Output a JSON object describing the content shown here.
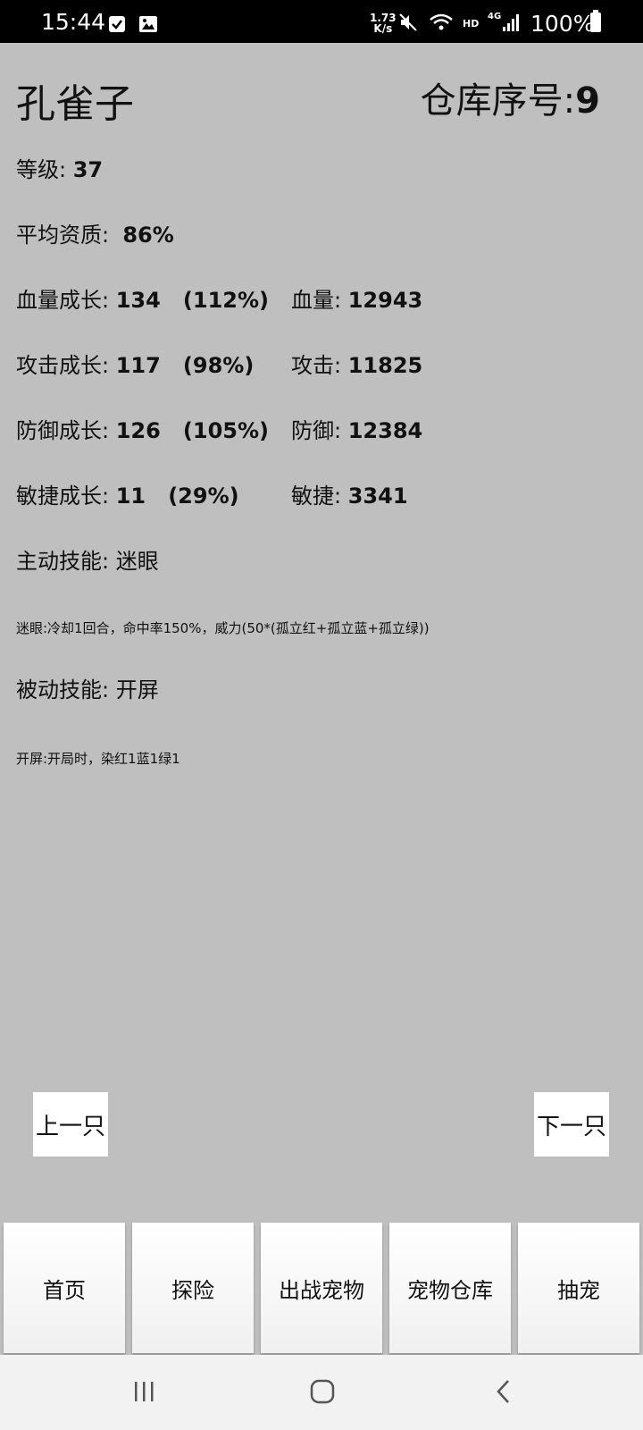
{
  "status_bar": {
    "time": "15:44",
    "net_speed_value": "1.73",
    "net_speed_unit": "K/s",
    "hd_label": "HD",
    "network_type": "4G",
    "battery_percent": "100%"
  },
  "header": {
    "pet_name": "孔雀子",
    "warehouse_label": "仓库序号:",
    "warehouse_number": "9"
  },
  "stats": {
    "level_label": "等级:",
    "level_value": "37",
    "avg_quality_label": "平均资质:",
    "avg_quality_value": "86%",
    "hp_growth_label": "血量成长:",
    "hp_growth_value": "134   (112%)",
    "hp_label": "血量:",
    "hp_value": "12943",
    "atk_growth_label": "攻击成长:",
    "atk_growth_value": "117   (98%)",
    "atk_label": "攻击:",
    "atk_value": "11825",
    "def_growth_label": "防御成长:",
    "def_growth_value": "126   (105%)",
    "def_label": "防御:",
    "def_value": "12384",
    "agi_growth_label": "敏捷成长:",
    "agi_growth_value": "11   (29%)",
    "agi_label": "敏捷:",
    "agi_value": "3341"
  },
  "skills": {
    "active_label": "主动技能:",
    "active_name": "迷眼",
    "active_desc": "迷眼:冷却1回合，命中率150%，威力(50*(孤立红+孤立蓝+孤立绿))",
    "passive_label": "被动技能:",
    "passive_name": "开屏",
    "passive_desc": "开屏:开局时，染红1蓝1绿1"
  },
  "nav": {
    "prev_label": "上一只",
    "next_label": "下一只"
  },
  "tabs": [
    {
      "label": "首页"
    },
    {
      "label": "探险"
    },
    {
      "label": "出战宠物"
    },
    {
      "label": "宠物仓库"
    },
    {
      "label": "抽宠"
    }
  ],
  "colors": {
    "background": "#bfbfbf",
    "button": "#ffffff"
  }
}
